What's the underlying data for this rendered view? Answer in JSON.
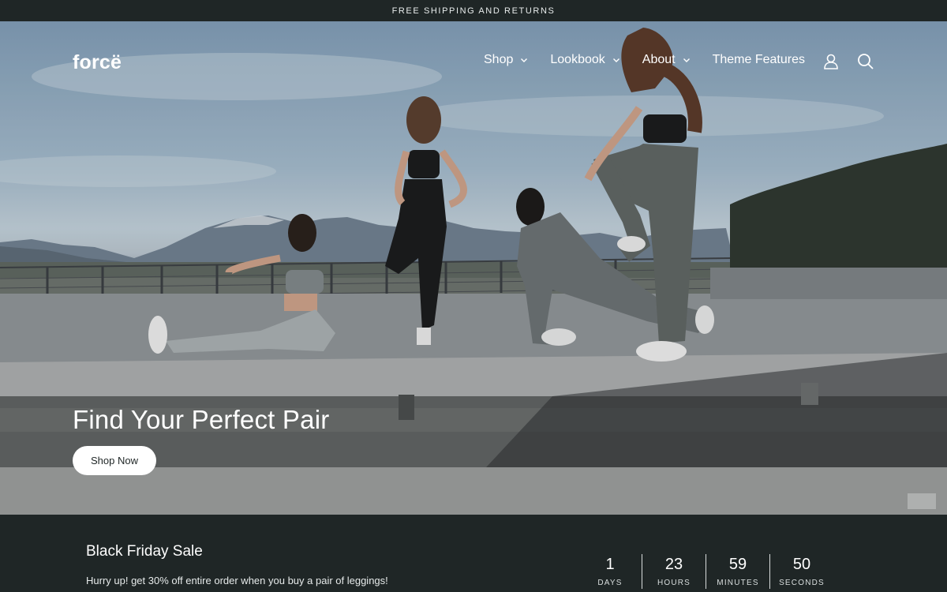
{
  "announcement": "FREE SHIPPING AND RETURNS",
  "header": {
    "logo": "forcë",
    "nav": [
      {
        "label": "Shop",
        "has_dropdown": true
      },
      {
        "label": "Lookbook",
        "has_dropdown": true
      },
      {
        "label": "About",
        "has_dropdown": true
      },
      {
        "label": "Theme Features",
        "has_dropdown": false
      }
    ],
    "icons": [
      "account-icon",
      "search-icon"
    ]
  },
  "hero": {
    "title": "Find Your Perfect Pair",
    "button_label": "Shop Now"
  },
  "sale": {
    "title": "Black Friday Sale",
    "text": "Hurry up! get 30% off entire order when you buy a pair of leggings!",
    "countdown": [
      {
        "value": "1",
        "label": "DAYS"
      },
      {
        "value": "23",
        "label": "HOURS"
      },
      {
        "value": "59",
        "label": "MINUTES"
      },
      {
        "value": "50",
        "label": "SECONDS"
      }
    ]
  },
  "colors": {
    "dark": "#1f2626",
    "white": "#ffffff"
  }
}
